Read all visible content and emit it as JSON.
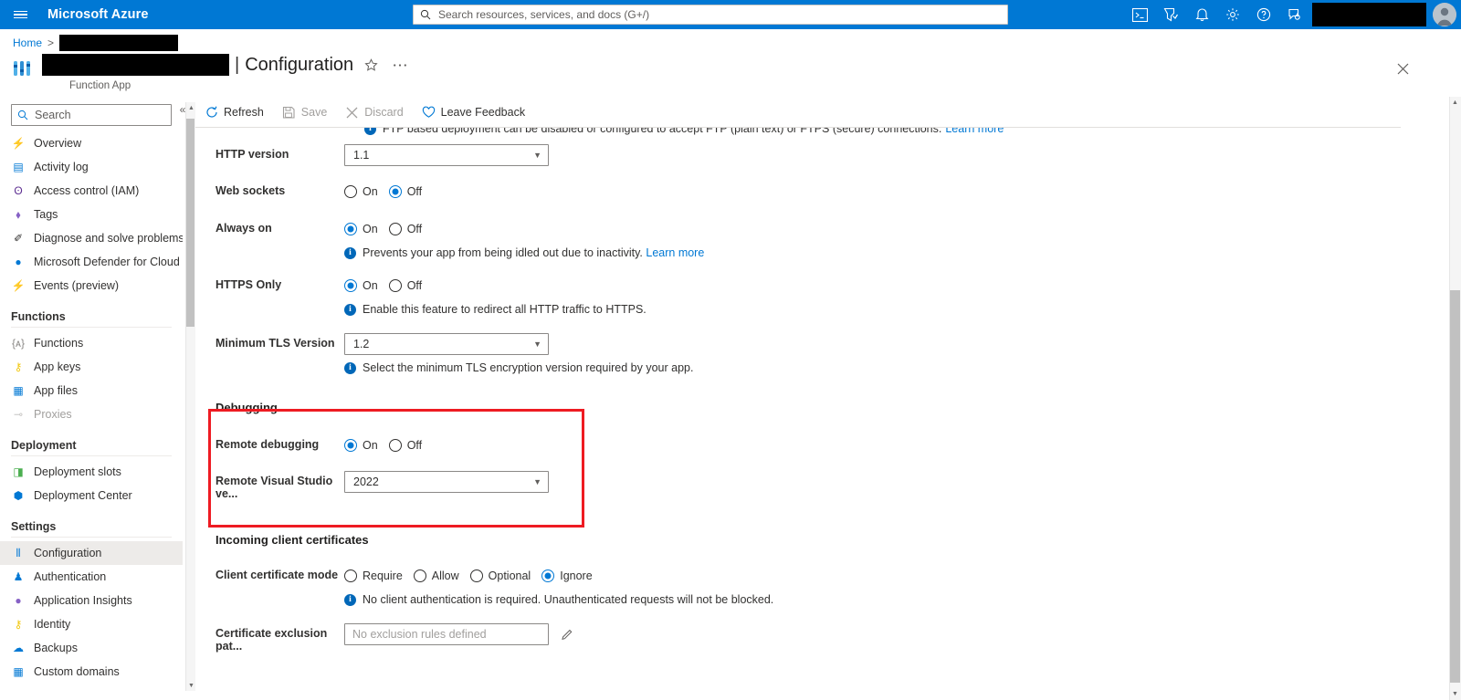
{
  "topbar": {
    "brand": "Microsoft Azure",
    "menu_icon": "hamburger-icon",
    "search_placeholder": "Search resources, services, and docs (G+/)",
    "search_value": "",
    "icons": [
      "cloud-shell-icon",
      "directory-filter-icon",
      "notifications-bell-icon",
      "settings-gear-icon",
      "help-question-icon",
      "feedback-smiley-icon"
    ],
    "accent": "#0078d4"
  },
  "breadcrumb": {
    "home": "Home",
    "separator": ">",
    "resource_redacted": true
  },
  "page": {
    "title": "Configuration",
    "pipe": "|",
    "subtitle": "Function App",
    "favorite_icon": "star-icon",
    "more_icon": "ellipsis-icon",
    "close_icon": "close-icon"
  },
  "sidebar": {
    "search_placeholder": "Search",
    "search_value": "",
    "collapse_label": "«",
    "items": [
      {
        "label": "Overview",
        "icon": "overview-icon",
        "glyph": "⚡",
        "color": "#0078d4",
        "selected": false,
        "disabled": false
      },
      {
        "label": "Activity log",
        "icon": "activity-log-icon",
        "glyph": "▤",
        "color": "#0078d4",
        "selected": false,
        "disabled": false
      },
      {
        "label": "Access control (IAM)",
        "icon": "access-control-icon",
        "glyph": "ʘ",
        "color": "#5c2d91",
        "selected": false,
        "disabled": false
      },
      {
        "label": "Tags",
        "icon": "tags-icon",
        "glyph": "⬧",
        "color": "#8661c5",
        "selected": false,
        "disabled": false
      },
      {
        "label": "Diagnose and solve problems",
        "icon": "diagnose-icon",
        "glyph": "✐",
        "color": "#323130",
        "selected": false,
        "disabled": false
      },
      {
        "label": "Microsoft Defender for Cloud",
        "icon": "defender-shield-icon",
        "glyph": "●",
        "color": "#0078d4",
        "selected": false,
        "disabled": false
      },
      {
        "label": "Events (preview)",
        "icon": "events-icon",
        "glyph": "⚡",
        "color": "#f2c811",
        "selected": false,
        "disabled": false
      }
    ],
    "groups": [
      {
        "title": "Functions",
        "items": [
          {
            "label": "Functions",
            "icon": "functions-icon",
            "glyph": "{ᴀ}",
            "color": "#8a8886",
            "selected": false,
            "disabled": false
          },
          {
            "label": "App keys",
            "icon": "app-keys-icon",
            "glyph": "⚷",
            "color": "#f2c811",
            "selected": false,
            "disabled": false
          },
          {
            "label": "App files",
            "icon": "app-files-icon",
            "glyph": "▦",
            "color": "#0078d4",
            "selected": false,
            "disabled": false
          },
          {
            "label": "Proxies",
            "icon": "proxies-icon",
            "glyph": "⊸",
            "color": "#9fd89f",
            "selected": false,
            "disabled": true
          }
        ]
      },
      {
        "title": "Deployment",
        "items": [
          {
            "label": "Deployment slots",
            "icon": "deployment-slots-icon",
            "glyph": "◨",
            "color": "#4caf50",
            "selected": false,
            "disabled": false
          },
          {
            "label": "Deployment Center",
            "icon": "deployment-center-icon",
            "glyph": "⬢",
            "color": "#0078d4",
            "selected": false,
            "disabled": false
          }
        ]
      },
      {
        "title": "Settings",
        "items": [
          {
            "label": "Configuration",
            "icon": "configuration-sliders-icon",
            "glyph": "⫴",
            "color": "#0078d4",
            "selected": true,
            "disabled": false
          },
          {
            "label": "Authentication",
            "icon": "authentication-icon",
            "glyph": "♟",
            "color": "#0078d4",
            "selected": false,
            "disabled": false
          },
          {
            "label": "Application Insights",
            "icon": "application-insights-icon",
            "glyph": "●",
            "color": "#8661c5",
            "selected": false,
            "disabled": false
          },
          {
            "label": "Identity",
            "icon": "identity-icon",
            "glyph": "⚷",
            "color": "#f2c811",
            "selected": false,
            "disabled": false
          },
          {
            "label": "Backups",
            "icon": "backups-icon",
            "glyph": "☁",
            "color": "#0078d4",
            "selected": false,
            "disabled": false
          },
          {
            "label": "Custom domains",
            "icon": "custom-domains-icon",
            "glyph": "▦",
            "color": "#0078d4",
            "selected": false,
            "disabled": false
          }
        ]
      }
    ]
  },
  "toolbar": {
    "refresh": "Refresh",
    "save": "Save",
    "discard": "Discard",
    "leave_feedback": "Leave Feedback",
    "save_enabled": false,
    "discard_enabled": false
  },
  "content": {
    "clipped_row": {
      "text": "FTP based deployment can be disabled or configured to accept FTP (plain text) or FTPS (secure) connections.",
      "link": "Learn more"
    },
    "http_version": {
      "label": "HTTP version",
      "value": "1.1"
    },
    "web_sockets": {
      "label": "Web sockets",
      "options": [
        "On",
        "Off"
      ],
      "selected": "Off"
    },
    "always_on": {
      "label": "Always on",
      "options": [
        "On",
        "Off"
      ],
      "selected": "On",
      "hint": "Prevents your app from being idled out due to inactivity.",
      "hint_link": "Learn more"
    },
    "https_only": {
      "label": "HTTPS Only",
      "options": [
        "On",
        "Off"
      ],
      "selected": "On",
      "hint": "Enable this feature to redirect all HTTP traffic to HTTPS."
    },
    "minimum_tls": {
      "label": "Minimum TLS Version",
      "value": "1.2",
      "hint": "Select the minimum TLS encryption version required by your app."
    },
    "debugging": {
      "section_title": "Debugging",
      "highlight_color": "#ee1b22",
      "remote_debugging": {
        "label": "Remote debugging",
        "options": [
          "On",
          "Off"
        ],
        "selected": "On"
      },
      "remote_vs_version": {
        "label": "Remote Visual Studio ve...",
        "value": "2022"
      }
    },
    "incoming_client_certificates": {
      "section_title": "Incoming client certificates",
      "client_certificate_mode": {
        "label": "Client certificate mode",
        "options": [
          "Require",
          "Allow",
          "Optional",
          "Ignore"
        ],
        "selected": "Ignore",
        "hint": "No client authentication is required. Unauthenticated requests will not be blocked."
      },
      "certificate_exclusion_paths": {
        "label": "Certificate exclusion pat...",
        "placeholder": "No exclusion rules defined",
        "value": "",
        "edit_icon": "pencil-icon"
      }
    }
  }
}
